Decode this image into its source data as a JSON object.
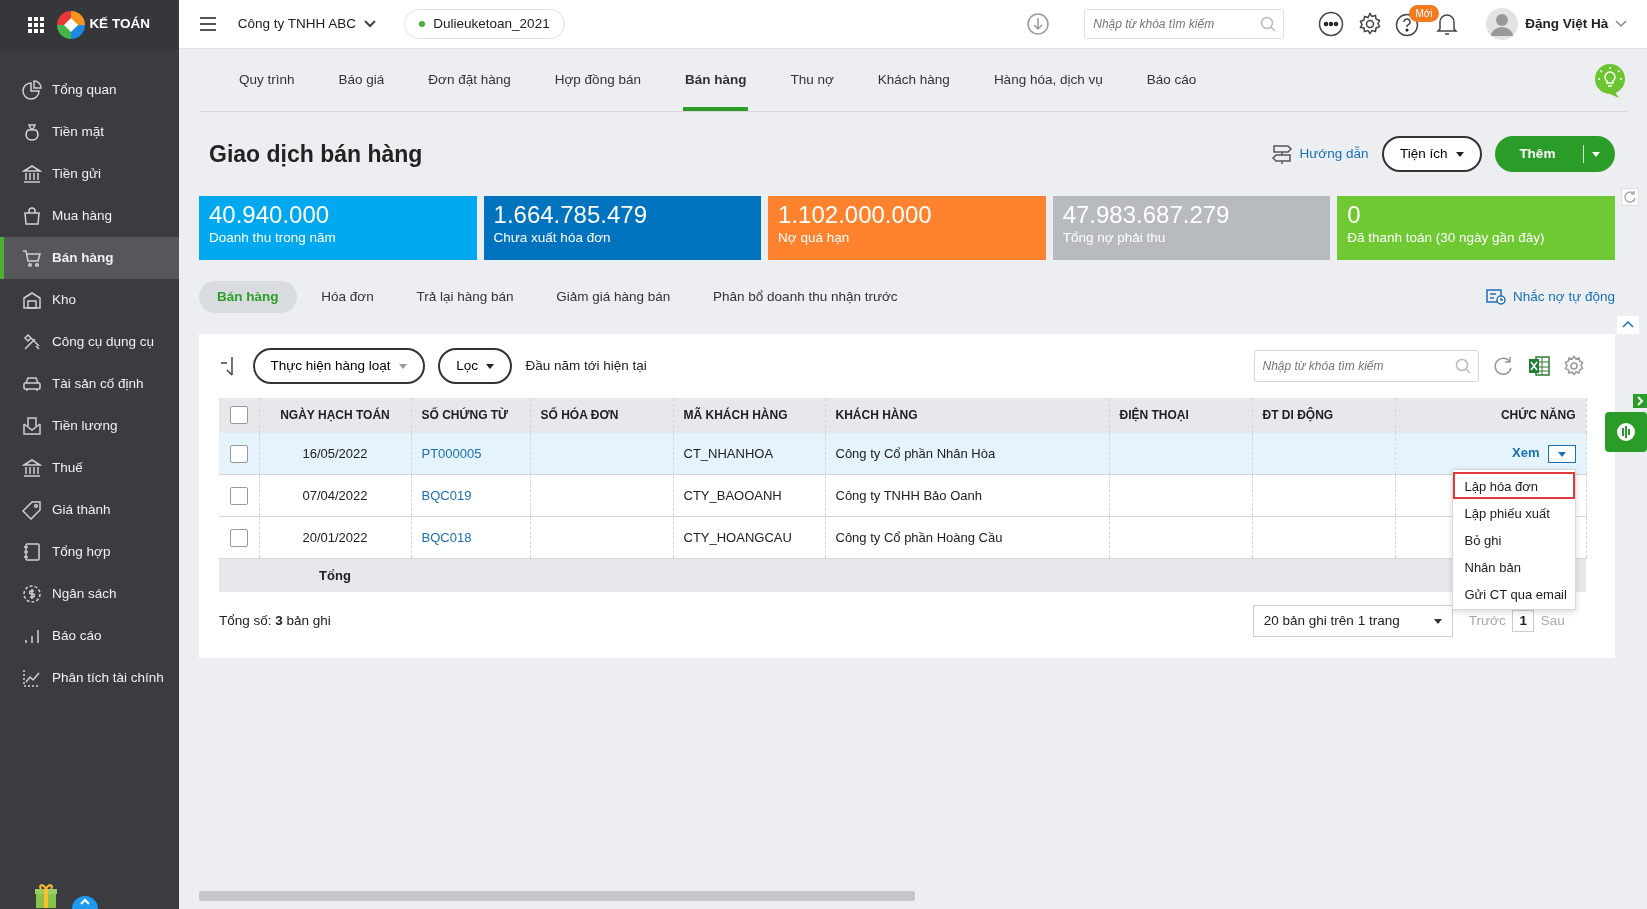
{
  "app": {
    "logo_text": "KẾ TOÁN"
  },
  "sidebar": {
    "items": [
      {
        "label": "Tổng quan",
        "selected": false
      },
      {
        "label": "Tiền mặt",
        "selected": false
      },
      {
        "label": "Tiền gửi",
        "selected": false
      },
      {
        "label": "Mua hàng",
        "selected": false
      },
      {
        "label": "Bán hàng",
        "selected": true
      },
      {
        "label": "Kho",
        "selected": false
      },
      {
        "label": "Công cụ dụng cụ",
        "selected": false
      },
      {
        "label": "Tài sản cố định",
        "selected": false
      },
      {
        "label": "Tiền lương",
        "selected": false
      },
      {
        "label": "Thuế",
        "selected": false
      },
      {
        "label": "Giá thành",
        "selected": false
      },
      {
        "label": "Tổng hợp",
        "selected": false
      },
      {
        "label": "Ngân sách",
        "selected": false
      },
      {
        "label": "Báo cáo",
        "selected": false
      },
      {
        "label": "Phân tích tài chính",
        "selected": false
      }
    ]
  },
  "header": {
    "company": "Công ty TNHH ABC",
    "database": "Dulieuketoan_2021",
    "search": {
      "placeholder": "Nhập từ khóa tìm kiếm"
    },
    "help_badge": "Mới",
    "user": "Đặng Việt Hà"
  },
  "module_tabs": [
    {
      "label": "Quy trình",
      "selected": false
    },
    {
      "label": "Báo giá",
      "selected": false
    },
    {
      "label": "Đơn đặt hàng",
      "selected": false
    },
    {
      "label": "Hợp đồng bán",
      "selected": false
    },
    {
      "label": "Bán hàng",
      "selected": true
    },
    {
      "label": "Thu nợ",
      "selected": false
    },
    {
      "label": "Khách hàng",
      "selected": false
    },
    {
      "label": "Hàng hóa, dịch vụ",
      "selected": false
    },
    {
      "label": "Báo cáo",
      "selected": false
    }
  ],
  "page": {
    "title": "Giao dịch bán hàng",
    "guide_link": "Hướng dẫn",
    "utility_button": "Tiện ích",
    "add_button": "Thêm"
  },
  "kpis": [
    {
      "value": "40.940.000",
      "label": "Doanh thu trong năm",
      "color": "#00a9ef"
    },
    {
      "value": "1.664.785.479",
      "label": "Chưa xuất hóa đơn",
      "color": "#0073be"
    },
    {
      "value": "1.102.000.000",
      "label": "Nợ quá hạn",
      "color": "#ff822e"
    },
    {
      "value": "47.983.687.279",
      "label": "Tổng nợ phải thu",
      "color": "#b7babf"
    },
    {
      "value": "0",
      "label": "Đã thanh toán (30 ngày gần đây)",
      "color": "#6fc933"
    }
  ],
  "sub_tabs": [
    {
      "label": "Bán hàng",
      "selected": true
    },
    {
      "label": "Hóa đơn",
      "selected": false
    },
    {
      "label": "Trả lại hàng bán",
      "selected": false
    },
    {
      "label": "Giảm giá hàng bán",
      "selected": false
    },
    {
      "label": "Phân bổ doanh thu nhận trước",
      "selected": false
    }
  ],
  "reminder_link": "Nhắc nợ tự động",
  "toolbar": {
    "bulk_button": "Thực hiện hàng loạt",
    "filter_button": "Lọc",
    "period": "Đầu năm tới hiện tại",
    "search": {
      "placeholder": "Nhập từ khóa tìm kiếm"
    }
  },
  "table": {
    "columns": [
      "NGÀY HẠCH TOÁN",
      "SỐ CHỨNG TỪ",
      "SỐ HÓA ĐƠN",
      "MÃ KHÁCH HÀNG",
      "KHÁCH HÀNG",
      "ĐIỆN THOẠI",
      "ĐT DI ĐỘNG",
      "CHỨC NĂNG"
    ],
    "rows": [
      {
        "date": "16/05/2022",
        "voucher": "PT000005",
        "customer_code": "CT_NHANHOA",
        "customer": "Công ty Cổ phần Nhân Hòa",
        "checked": false,
        "selected": true,
        "action": "Xem"
      },
      {
        "date": "07/04/2022",
        "voucher": "BQC019",
        "customer_code": "CTY_BAOOANH",
        "customer": "Công ty TNHH Bảo Oanh",
        "checked": false,
        "selected": false
      },
      {
        "date": "20/01/2022",
        "voucher": "BQC018",
        "customer_code": "CTY_HOANGCAU",
        "customer": "Công ty Cổ phần Hoàng Cầu",
        "checked": false,
        "selected": false
      }
    ],
    "total_label": "Tổng",
    "select_all_checked": false
  },
  "row_menu": [
    {
      "label": "Lập hóa đơn",
      "highlighted": true
    },
    {
      "label": "Lập phiếu xuất",
      "highlighted": false
    },
    {
      "label": "Bỏ ghi",
      "highlighted": false
    },
    {
      "label": "Nhân bản",
      "highlighted": false
    },
    {
      "label": "Gửi CT qua email",
      "highlighted": false
    }
  ],
  "footer": {
    "summary": "Tổng số: **3** bản ghi",
    "page_size": "20 bản ghi trên 1 trang",
    "prev": "Trước",
    "page": "1",
    "next": "Sau"
  }
}
